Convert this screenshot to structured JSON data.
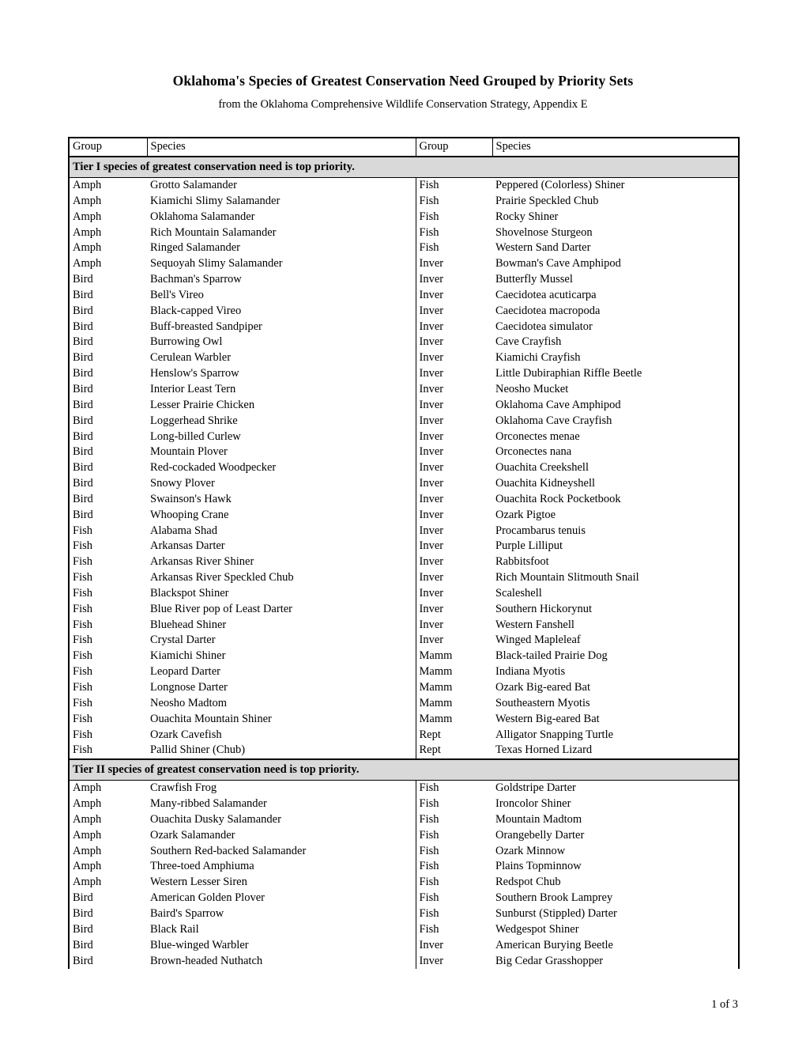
{
  "document": {
    "title": "Oklahoma's Species of Greatest Conservation Need Grouped by Priority Sets",
    "subtitle": "from the Oklahoma Comprehensive Wildlife Conservation Strategy, Appendix E",
    "footer": "1 of 3"
  },
  "table": {
    "headers": {
      "group_left": "Group",
      "species_left": "Species",
      "group_right": "Group",
      "species_right": "Species"
    },
    "sections": [
      {
        "banner": "Tier I species of greatest conservation need is top priority.",
        "rows": [
          {
            "group_left": "Amph",
            "species_left": "Grotto Salamander",
            "group_right": "Fish",
            "species_right": "Peppered (Colorless) Shiner"
          },
          {
            "group_left": "Amph",
            "species_left": "Kiamichi Slimy Salamander",
            "group_right": "Fish",
            "species_right": "Prairie Speckled Chub"
          },
          {
            "group_left": "Amph",
            "species_left": "Oklahoma Salamander",
            "group_right": "Fish",
            "species_right": "Rocky Shiner"
          },
          {
            "group_left": "Amph",
            "species_left": "Rich Mountain Salamander",
            "group_right": "Fish",
            "species_right": "Shovelnose Sturgeon"
          },
          {
            "group_left": "Amph",
            "species_left": "Ringed Salamander",
            "group_right": "Fish",
            "species_right": "Western Sand Darter"
          },
          {
            "group_left": "Amph",
            "species_left": "Sequoyah Slimy Salamander",
            "group_right": "Inver",
            "species_right": "Bowman's Cave Amphipod"
          },
          {
            "group_left": "Bird",
            "species_left": "Bachman's Sparrow",
            "group_right": "Inver",
            "species_right": "Butterfly Mussel"
          },
          {
            "group_left": "Bird",
            "species_left": "Bell's Vireo",
            "group_right": "Inver",
            "species_right": "Caecidotea acuticarpa"
          },
          {
            "group_left": "Bird",
            "species_left": "Black-capped Vireo",
            "group_right": "Inver",
            "species_right": "Caecidotea macropoda"
          },
          {
            "group_left": "Bird",
            "species_left": "Buff-breasted Sandpiper",
            "group_right": "Inver",
            "species_right": "Caecidotea simulator"
          },
          {
            "group_left": "Bird",
            "species_left": "Burrowing Owl",
            "group_right": "Inver",
            "species_right": "Cave Crayfish"
          },
          {
            "group_left": "Bird",
            "species_left": "Cerulean Warbler",
            "group_right": "Inver",
            "species_right": "Kiamichi Crayfish"
          },
          {
            "group_left": "Bird",
            "species_left": "Henslow's Sparrow",
            "group_right": "Inver",
            "species_right": "Little Dubiraphian Riffle Beetle"
          },
          {
            "group_left": "Bird",
            "species_left": "Interior Least Tern",
            "group_right": "Inver",
            "species_right": "Neosho Mucket"
          },
          {
            "group_left": "Bird",
            "species_left": "Lesser Prairie Chicken",
            "group_right": "Inver",
            "species_right": "Oklahoma Cave Amphipod"
          },
          {
            "group_left": "Bird",
            "species_left": "Loggerhead Shrike",
            "group_right": "Inver",
            "species_right": "Oklahoma Cave Crayfish"
          },
          {
            "group_left": "Bird",
            "species_left": "Long-billed Curlew",
            "group_right": "Inver",
            "species_right": "Orconectes menae"
          },
          {
            "group_left": "Bird",
            "species_left": "Mountain Plover",
            "group_right": "Inver",
            "species_right": "Orconectes nana"
          },
          {
            "group_left": "Bird",
            "species_left": "Red-cockaded Woodpecker",
            "group_right": "Inver",
            "species_right": "Ouachita Creekshell"
          },
          {
            "group_left": "Bird",
            "species_left": "Snowy Plover",
            "group_right": "Inver",
            "species_right": "Ouachita Kidneyshell"
          },
          {
            "group_left": "Bird",
            "species_left": "Swainson's Hawk",
            "group_right": "Inver",
            "species_right": "Ouachita Rock Pocketbook"
          },
          {
            "group_left": "Bird",
            "species_left": "Whooping Crane",
            "group_right": "Inver",
            "species_right": "Ozark Pigtoe"
          },
          {
            "group_left": "Fish",
            "species_left": "Alabama Shad",
            "group_right": "Inver",
            "species_right": "Procambarus tenuis"
          },
          {
            "group_left": "Fish",
            "species_left": "Arkansas Darter",
            "group_right": "Inver",
            "species_right": "Purple Lilliput"
          },
          {
            "group_left": "Fish",
            "species_left": "Arkansas River Shiner",
            "group_right": "Inver",
            "species_right": "Rabbitsfoot"
          },
          {
            "group_left": "Fish",
            "species_left": "Arkansas River Speckled Chub",
            "group_right": "Inver",
            "species_right": "Rich Mountain Slitmouth Snail"
          },
          {
            "group_left": "Fish",
            "species_left": "Blackspot Shiner",
            "group_right": "Inver",
            "species_right": "Scaleshell"
          },
          {
            "group_left": "Fish",
            "species_left": "Blue River pop of Least Darter",
            "group_right": "Inver",
            "species_right": "Southern Hickorynut"
          },
          {
            "group_left": "Fish",
            "species_left": "Bluehead Shiner",
            "group_right": "Inver",
            "species_right": "Western Fanshell"
          },
          {
            "group_left": "Fish",
            "species_left": "Crystal Darter",
            "group_right": "Inver",
            "species_right": "Winged Mapleleaf"
          },
          {
            "group_left": "Fish",
            "species_left": "Kiamichi Shiner",
            "group_right": "Mamm",
            "species_right": "Black-tailed Prairie Dog"
          },
          {
            "group_left": "Fish",
            "species_left": "Leopard Darter",
            "group_right": "Mamm",
            "species_right": "Indiana Myotis"
          },
          {
            "group_left": "Fish",
            "species_left": "Longnose Darter",
            "group_right": "Mamm",
            "species_right": "Ozark Big-eared Bat"
          },
          {
            "group_left": "Fish",
            "species_left": "Neosho Madtom",
            "group_right": "Mamm",
            "species_right": "Southeastern Myotis"
          },
          {
            "group_left": "Fish",
            "species_left": "Ouachita Mountain Shiner",
            "group_right": "Mamm",
            "species_right": "Western Big-eared Bat"
          },
          {
            "group_left": "Fish",
            "species_left": "Ozark Cavefish",
            "group_right": "Rept",
            "species_right": "Alligator Snapping Turtle"
          },
          {
            "group_left": "Fish",
            "species_left": "Pallid Shiner (Chub)",
            "group_right": "Rept",
            "species_right": "Texas Horned Lizard"
          }
        ]
      },
      {
        "banner": "Tier II species of greatest conservation need is top priority.",
        "rows": [
          {
            "group_left": "Amph",
            "species_left": "Crawfish Frog",
            "group_right": "Fish",
            "species_right": "Goldstripe Darter"
          },
          {
            "group_left": "Amph",
            "species_left": "Many-ribbed Salamander",
            "group_right": "Fish",
            "species_right": "Ironcolor Shiner"
          },
          {
            "group_left": "Amph",
            "species_left": "Ouachita Dusky Salamander",
            "group_right": "Fish",
            "species_right": "Mountain Madtom"
          },
          {
            "group_left": "Amph",
            "species_left": "Ozark Salamander",
            "group_right": "Fish",
            "species_right": "Orangebelly Darter"
          },
          {
            "group_left": "Amph",
            "species_left": "Southern Red-backed Salamander",
            "group_right": "Fish",
            "species_right": "Ozark Minnow"
          },
          {
            "group_left": "Amph",
            "species_left": "Three-toed Amphiuma",
            "group_right": "Fish",
            "species_right": "Plains Topminnow"
          },
          {
            "group_left": "Amph",
            "species_left": "Western Lesser Siren",
            "group_right": "Fish",
            "species_right": "Redspot Chub"
          },
          {
            "group_left": "Bird",
            "species_left": "American Golden Plover",
            "group_right": "Fish",
            "species_right": "Southern Brook Lamprey"
          },
          {
            "group_left": "Bird",
            "species_left": "Baird's Sparrow",
            "group_right": "Fish",
            "species_right": "Sunburst (Stippled) Darter"
          },
          {
            "group_left": "Bird",
            "species_left": "Black Rail",
            "group_right": "Fish",
            "species_right": "Wedgespot Shiner"
          },
          {
            "group_left": "Bird",
            "species_left": "Blue-winged Warbler",
            "group_right": "Inver",
            "species_right": "American Burying Beetle"
          },
          {
            "group_left": "Bird",
            "species_left": "Brown-headed Nuthatch",
            "group_right": "Inver",
            "species_right": "Big Cedar Grasshopper"
          }
        ]
      }
    ]
  }
}
